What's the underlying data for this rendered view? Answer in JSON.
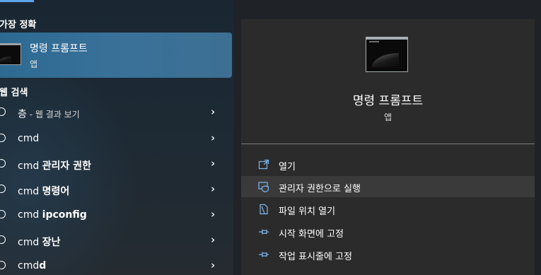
{
  "left": {
    "best_match_title": "가장 정확",
    "best_match": {
      "name": "명령 프롬프트",
      "type": "앱"
    },
    "web_title": "웹 검색",
    "web_results": [
      {
        "main": "층",
        "suffix": " - 웹 결과 보기",
        "bold": false
      },
      {
        "main": "cmd",
        "suffix": "",
        "bold": false
      },
      {
        "main": "cmd ",
        "strong": "관리자 권한"
      },
      {
        "main": "cmd ",
        "strong": "명령어"
      },
      {
        "main": "cmd ",
        "strong": "ipconfig"
      },
      {
        "main": "cmd ",
        "strong": "장난"
      },
      {
        "main": "cmd",
        "strong": "d"
      }
    ]
  },
  "right": {
    "app_name": "명령 프롬프트",
    "app_type": "앱",
    "actions": [
      {
        "label": "열기",
        "icon": "open-icon"
      },
      {
        "label": "관리자 권한으로 실행",
        "icon": "shield-icon"
      },
      {
        "label": "파일 위치 열기",
        "icon": "file-location-icon"
      },
      {
        "label": "시작 화면에 고정",
        "icon": "pin-icon"
      },
      {
        "label": "작업 표시줄에 고정",
        "icon": "pin-icon"
      }
    ]
  },
  "colors": {
    "accent": "#5ea6e8",
    "best_match_bg": "#3a7199",
    "detail_bg": "#2b2b2b",
    "action_icon": "#7fb8f0"
  }
}
